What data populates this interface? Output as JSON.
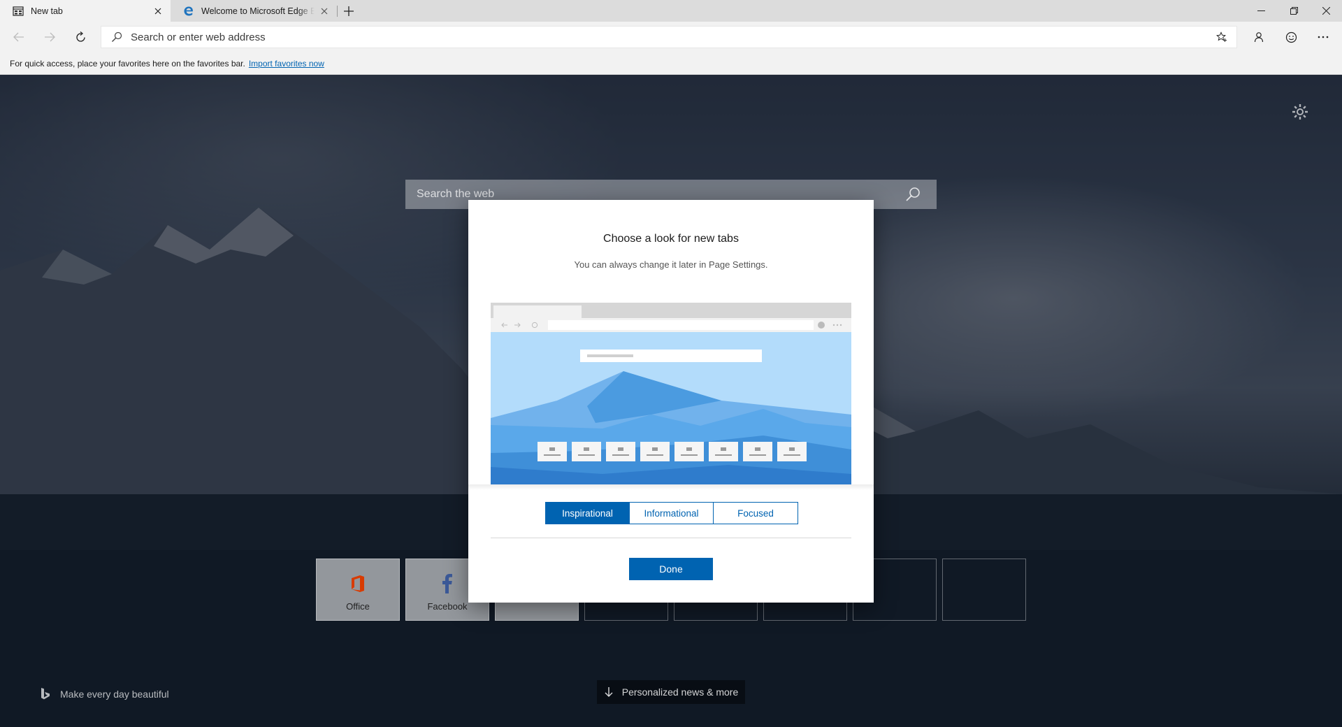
{
  "tabs": [
    {
      "title": "New tab",
      "icon": "new-tab-page-icon",
      "active": true
    },
    {
      "title": "Welcome to Microsoft Edge Beta",
      "icon": "edge-logo-icon",
      "active": false
    }
  ],
  "window_controls": [
    "minimize-icon",
    "restore-icon",
    "close-icon"
  ],
  "address_bar": {
    "placeholder": "Search or enter web address",
    "value": ""
  },
  "favorites_bar": {
    "message": "For quick access, place your favorites here on the favorites bar.",
    "link_label": "Import favorites now"
  },
  "new_tab_page": {
    "search_placeholder": "Search the web",
    "tiles": [
      {
        "label": "Office",
        "icon": "office-icon"
      },
      {
        "label": "Facebook",
        "icon": "facebook-icon"
      },
      {
        "label": "",
        "icon": ""
      },
      {
        "label": "",
        "icon": ""
      },
      {
        "label": "",
        "icon": ""
      },
      {
        "label": "",
        "icon": ""
      },
      {
        "label": "",
        "icon": ""
      },
      {
        "label": "",
        "icon": ""
      }
    ],
    "bing_tagline": "Make every day beautiful",
    "news_button": "Personalized news & more"
  },
  "modal": {
    "title": "Choose a look for new tabs",
    "subtitle": "You can always change it later in Page Settings.",
    "options": [
      "Inspirational",
      "Informational",
      "Focused"
    ],
    "selected_option": "Inspirational",
    "done_label": "Done"
  },
  "colors": {
    "accent": "#0063b1",
    "preview_sky": "#b3dcfb",
    "office_red": "#d83b01",
    "facebook_blue": "#3b5998"
  }
}
